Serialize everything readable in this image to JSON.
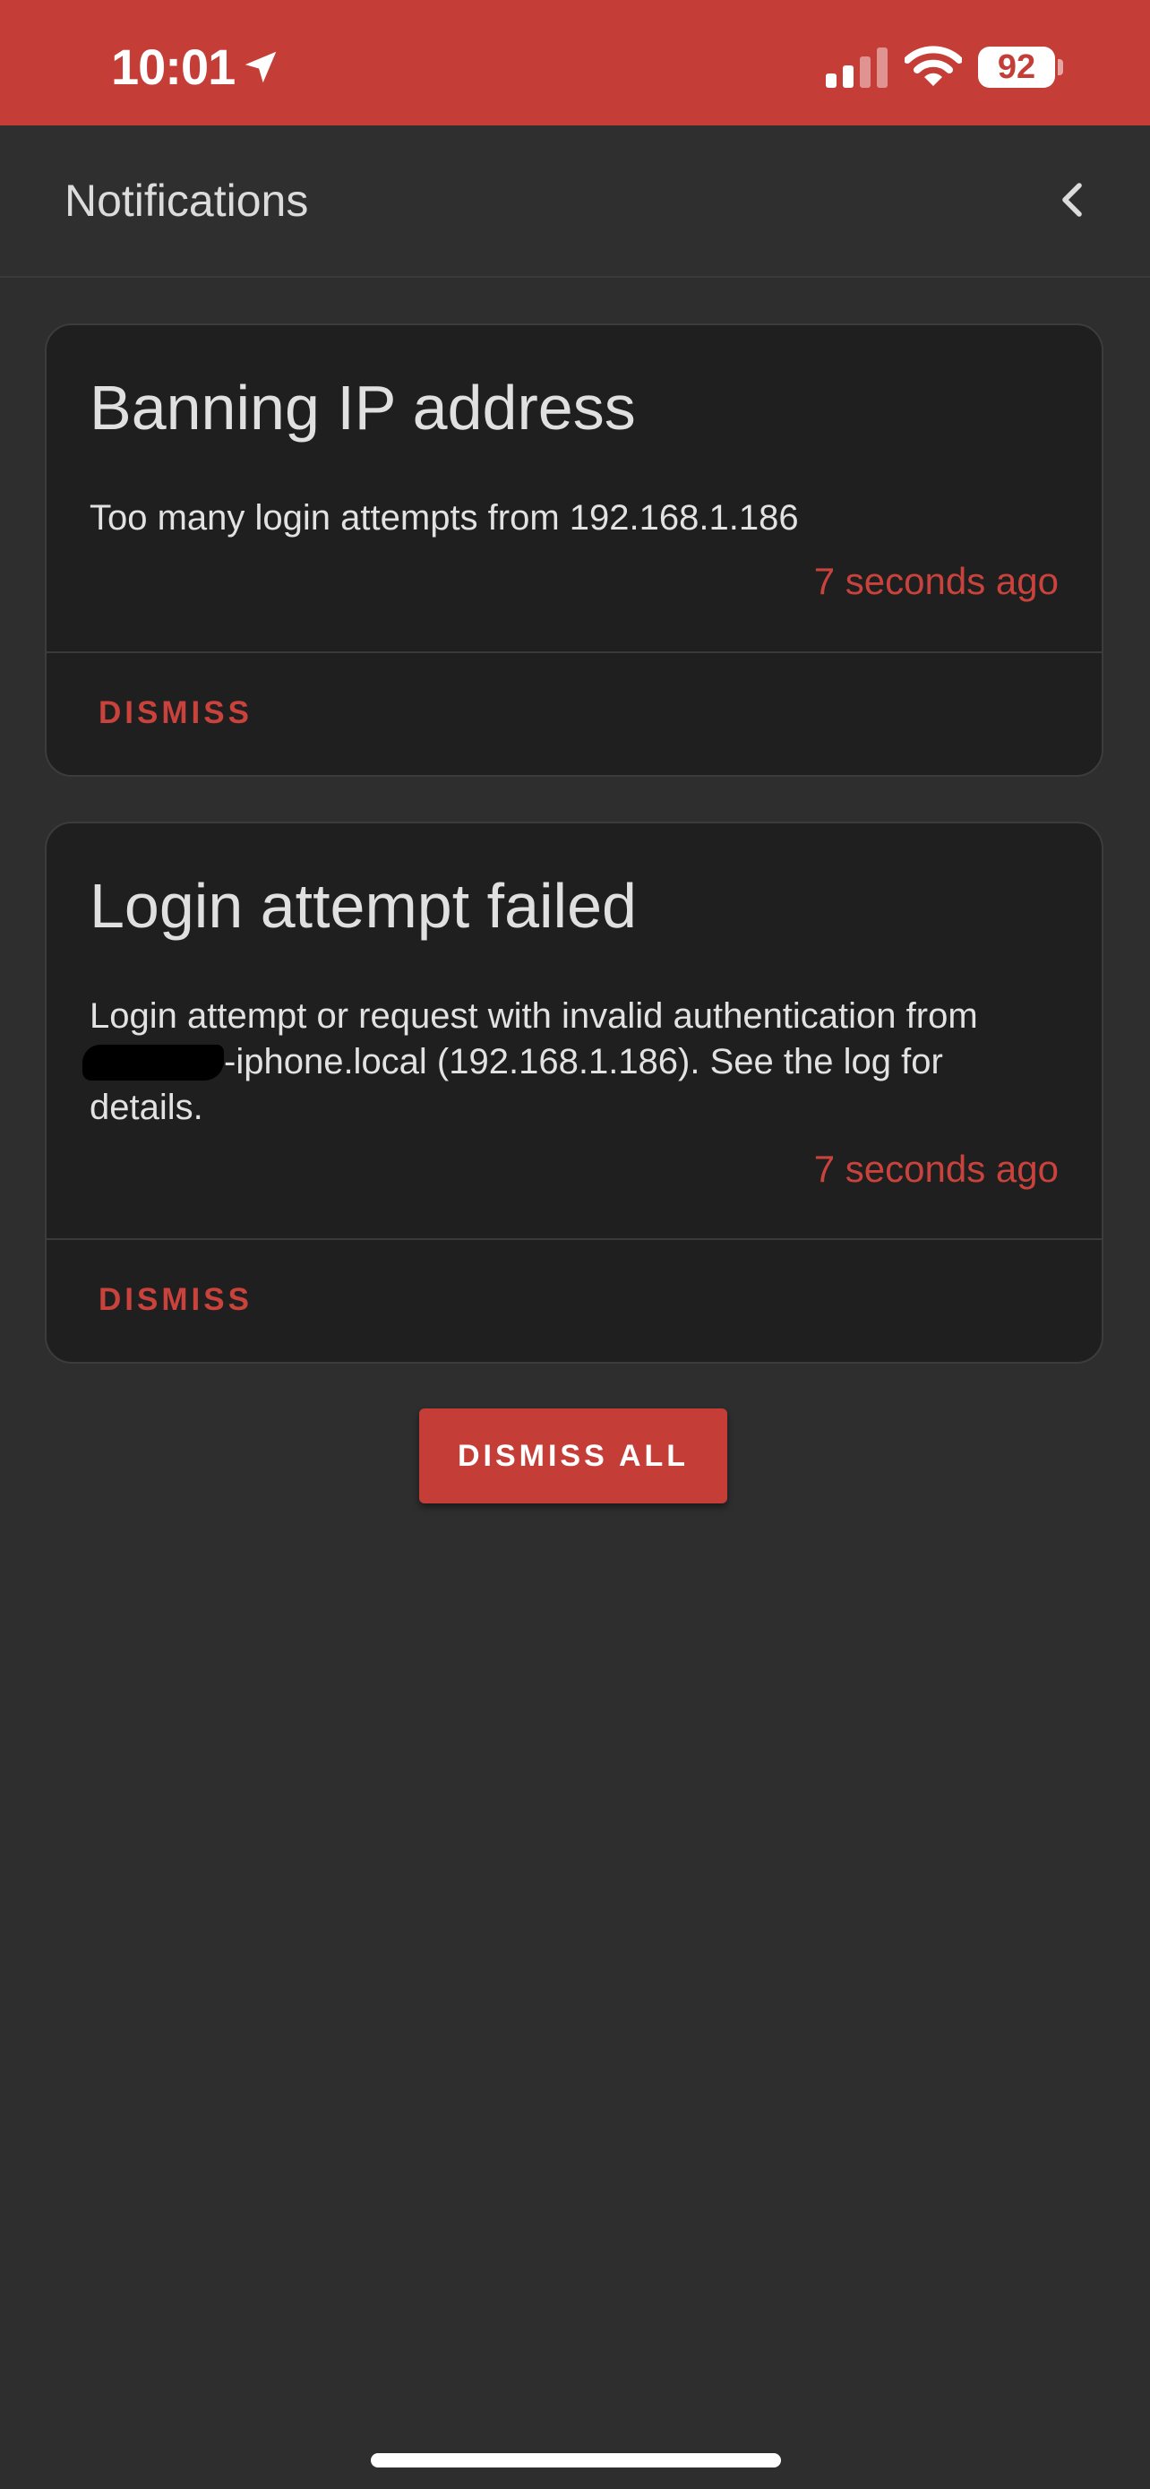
{
  "status_bar": {
    "time": "10:01",
    "battery": "92",
    "icons": [
      "location-arrow-icon",
      "cellular-signal-icon",
      "wifi-icon",
      "battery-icon"
    ],
    "background_color": "#c53d37"
  },
  "header": {
    "title": "Notifications",
    "back_icon": "chevron-left-icon"
  },
  "notifications": [
    {
      "title": "Banning IP address",
      "message": "Too many login attempts from 192.168.1.186",
      "time": "7 seconds ago",
      "action_label": "DISMISS"
    },
    {
      "title": "Login attempt failed",
      "message_before_redaction": "Login attempt or request with invalid authentication from ",
      "message_after_redaction": "-iphone.local (192.168.1.186). See the log for details.",
      "time": "7 seconds ago",
      "action_label": "DISMISS"
    }
  ],
  "dismiss_all_label": "DISMISS ALL",
  "colors": {
    "accent": "#c9423c",
    "background": "#2e2e2f",
    "card": "#1f1f20"
  }
}
